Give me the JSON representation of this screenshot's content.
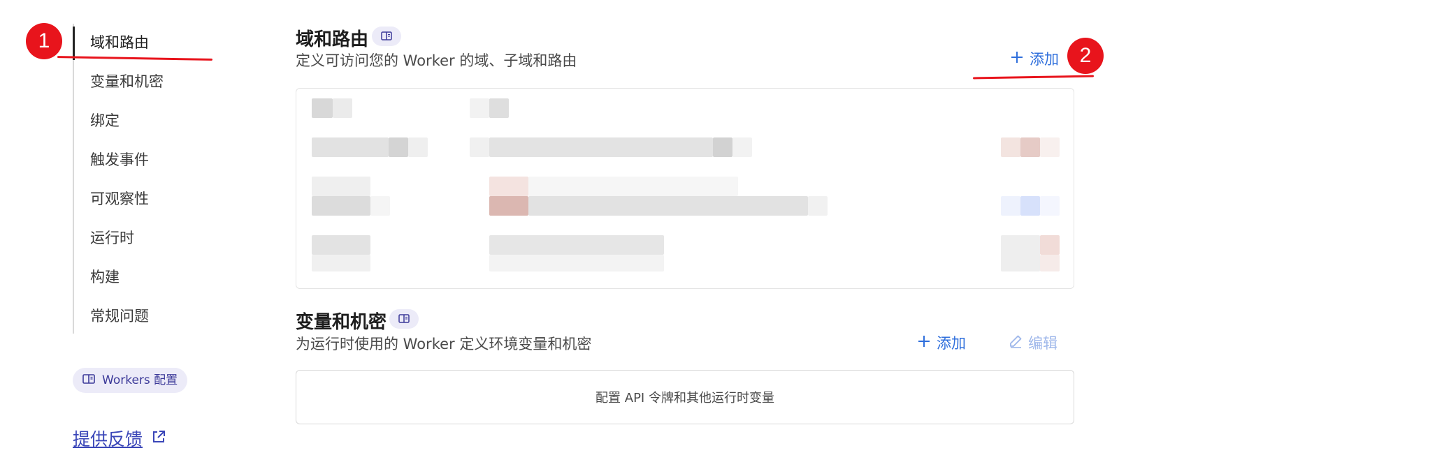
{
  "sidebar": {
    "items": [
      {
        "label": "域和路由"
      },
      {
        "label": "变量和机密"
      },
      {
        "label": "绑定"
      },
      {
        "label": "触发事件"
      },
      {
        "label": "可观察性"
      },
      {
        "label": "运行时"
      },
      {
        "label": "构建"
      },
      {
        "label": "常规问题"
      }
    ],
    "docs_pill": "Workers 配置",
    "feedback": "提供反馈"
  },
  "annotations": {
    "badge1": "1",
    "badge2": "2",
    "color": "#e8141c"
  },
  "routes": {
    "title": "域和路由",
    "subtitle": "定义可访问您的 Worker 的域、子域和路由",
    "add_label": "添加"
  },
  "variables": {
    "title": "变量和机密",
    "subtitle": "为运行时使用的 Worker 定义环境变量和机密",
    "add_label": "添加",
    "edit_label": "编辑",
    "empty_text": "配置 API 令牌和其他运行时变量"
  },
  "colors": {
    "link": "#2f6fdc",
    "accent_pill": "#ecebf8"
  }
}
